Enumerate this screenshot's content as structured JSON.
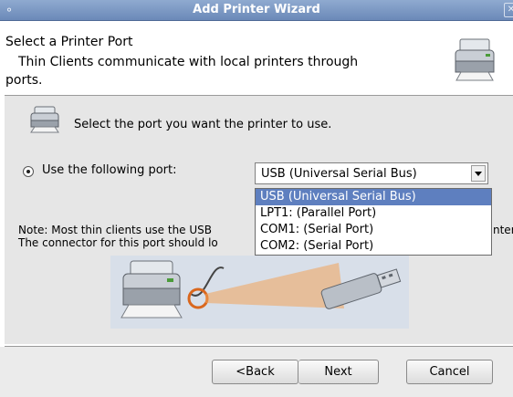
{
  "window": {
    "title": "Add Printer Wizard",
    "menu_icon": "window-menu-icon",
    "close_icon": "close-icon"
  },
  "header": {
    "title": "Select a Printer Port",
    "description_line1": "Thin Clients communicate with local printers through",
    "description_line2": "ports.",
    "icon": "printer-icon"
  },
  "content": {
    "instruction": "Select the port you want the printer to use.",
    "instruction_icon": "printer-icon",
    "radio_label": "Use the following port:",
    "radio_checked": true,
    "port_select": {
      "value": "USB (Universal Serial Bus)",
      "options": [
        "USB (Universal Serial Bus)",
        "LPT1: (Parallel Port)",
        "COM1: (Serial Port)",
        "COM2: (Serial Port)"
      ],
      "selected_index": 0
    },
    "note_line1": "Note: Most thin clients use the USB",
    "note_line1_tail": "nter",
    "note_line2": "The connector for this port should lo",
    "illustration_icons": [
      "printer-icon",
      "usb-connector-icon"
    ]
  },
  "buttons": {
    "back": "<Back",
    "next": "Next",
    "cancel": "Cancel"
  },
  "colors": {
    "titlebar": "#7a96c2",
    "selection": "#5e7fbf",
    "content_bg": "#e6e6e6",
    "illustration_bg": "#d8dfe9",
    "highlight_circle": "#d9671e"
  }
}
